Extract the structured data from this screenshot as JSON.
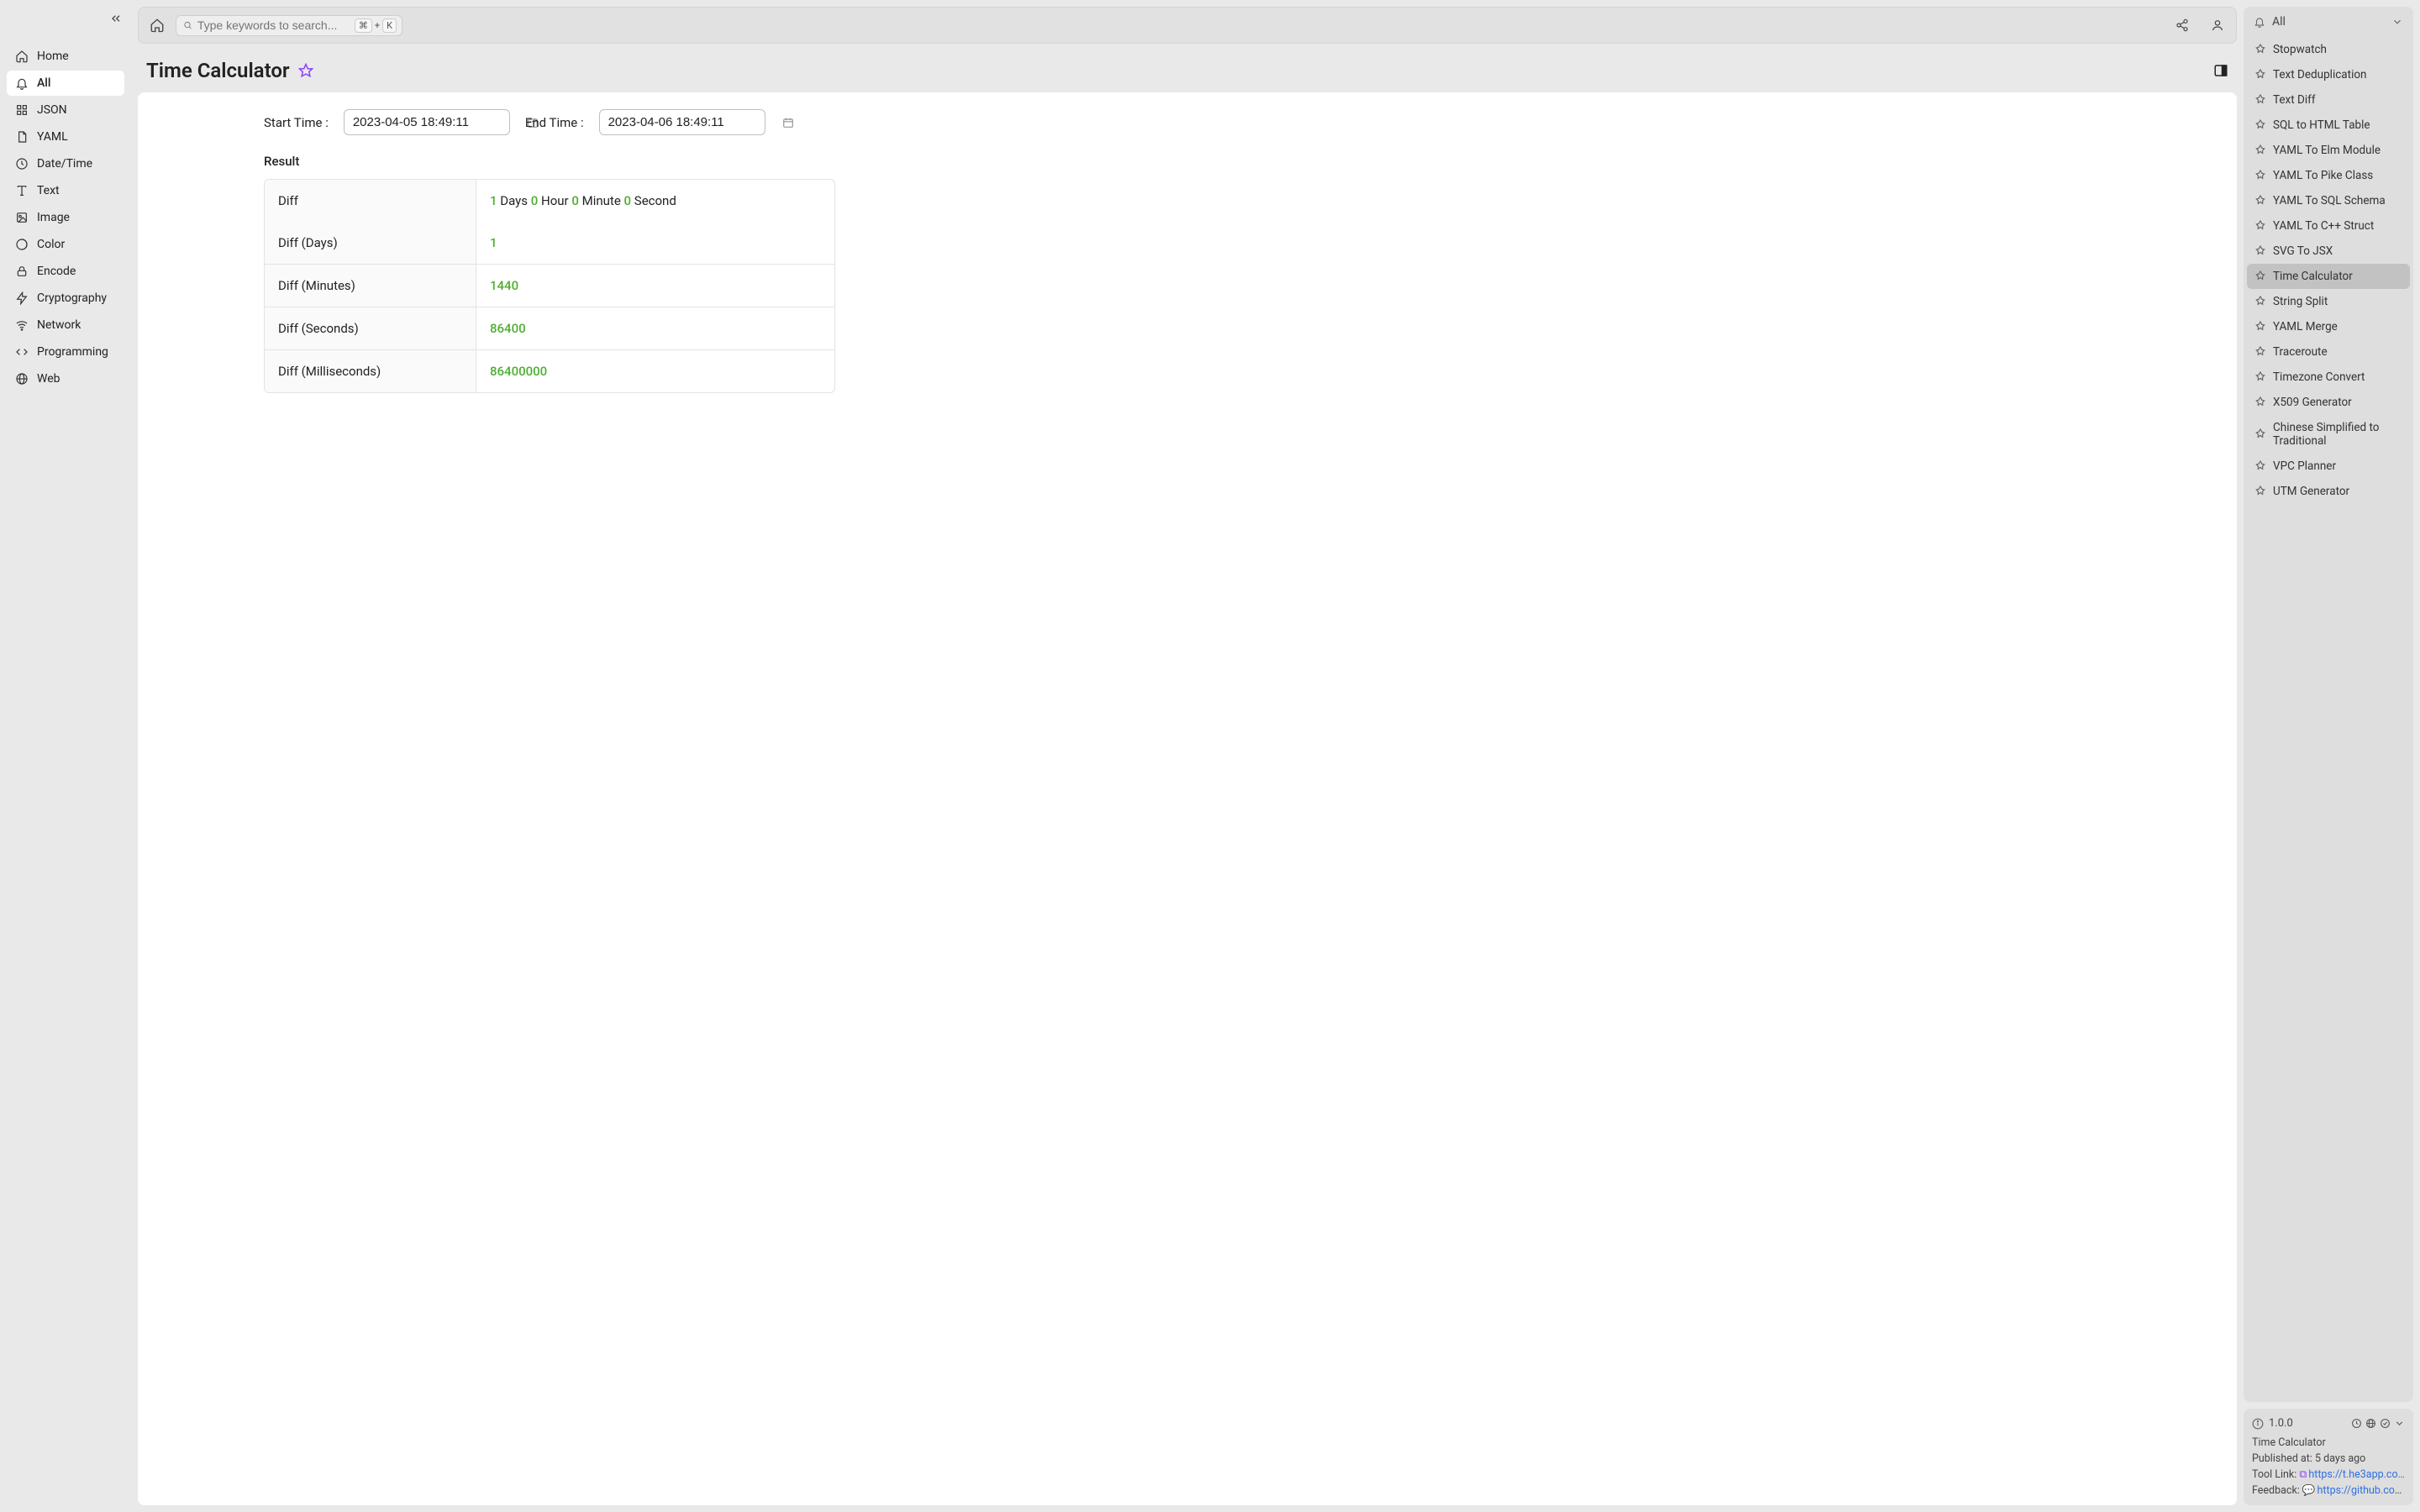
{
  "nav": {
    "items": [
      {
        "label": "Home",
        "icon": "home-icon"
      },
      {
        "label": "All",
        "icon": "bell-icon",
        "active": true
      },
      {
        "label": "JSON",
        "icon": "grid-icon"
      },
      {
        "label": "YAML",
        "icon": "doc-icon"
      },
      {
        "label": "Date/Time",
        "icon": "clock-icon"
      },
      {
        "label": "Text",
        "icon": "text-icon"
      },
      {
        "label": "Image",
        "icon": "image-icon"
      },
      {
        "label": "Color",
        "icon": "palette-icon"
      },
      {
        "label": "Encode",
        "icon": "lock-icon"
      },
      {
        "label": "Cryptography",
        "icon": "bolt-icon"
      },
      {
        "label": "Network",
        "icon": "wifi-icon"
      },
      {
        "label": "Programming",
        "icon": "code-icon"
      },
      {
        "label": "Web",
        "icon": "globe-icon"
      }
    ]
  },
  "topbar": {
    "search_placeholder": "Type keywords to search...",
    "kbd1": "⌘",
    "kbd_plus": "+",
    "kbd2": "K"
  },
  "header": {
    "title": "Time Calculator"
  },
  "form": {
    "start_label": "Start Time",
    "start_value": "2023-04-05 18:49:11",
    "end_label": "End Time",
    "end_value": "2023-04-06 18:49:11"
  },
  "result_label": "Result",
  "result": {
    "diff_label": "Diff",
    "diff_parts": {
      "days": "1",
      "days_u": "Days",
      "hours": "0",
      "hours_u": "Hour",
      "minutes": "0",
      "minutes_u": "Minute",
      "seconds": "0",
      "seconds_u": "Second"
    },
    "rows": [
      {
        "label": "Diff (Days)",
        "value": "1"
      },
      {
        "label": "Diff (Minutes)",
        "value": "1440"
      },
      {
        "label": "Diff (Seconds)",
        "value": "86400"
      },
      {
        "label": "Diff (Milliseconds)",
        "value": "86400000"
      }
    ]
  },
  "right": {
    "dropdown_label": "All",
    "tools": [
      {
        "label": "Stopwatch"
      },
      {
        "label": "Text Deduplication"
      },
      {
        "label": "Text Diff"
      },
      {
        "label": "SQL to HTML Table"
      },
      {
        "label": "YAML To Elm Module"
      },
      {
        "label": "YAML To Pike Class"
      },
      {
        "label": "YAML To SQL Schema"
      },
      {
        "label": "YAML To C++ Struct"
      },
      {
        "label": "SVG To JSX"
      },
      {
        "label": "Time Calculator",
        "active": true
      },
      {
        "label": "String Split"
      },
      {
        "label": "YAML Merge"
      },
      {
        "label": "Traceroute"
      },
      {
        "label": "Timezone Convert"
      },
      {
        "label": "X509 Generator"
      },
      {
        "label": "Chinese Simplified to Traditional"
      },
      {
        "label": "VPC Planner"
      },
      {
        "label": "UTM Generator"
      }
    ]
  },
  "info": {
    "version": "1.0.0",
    "title": "Time Calculator",
    "published_label": "Published at:",
    "published_value": "5 days ago",
    "tool_link_label": "Tool Link:",
    "tool_link_value": "https://t.he3app.co…",
    "feedback_label": "Feedback:",
    "feedback_value": "https://github.com/…"
  }
}
